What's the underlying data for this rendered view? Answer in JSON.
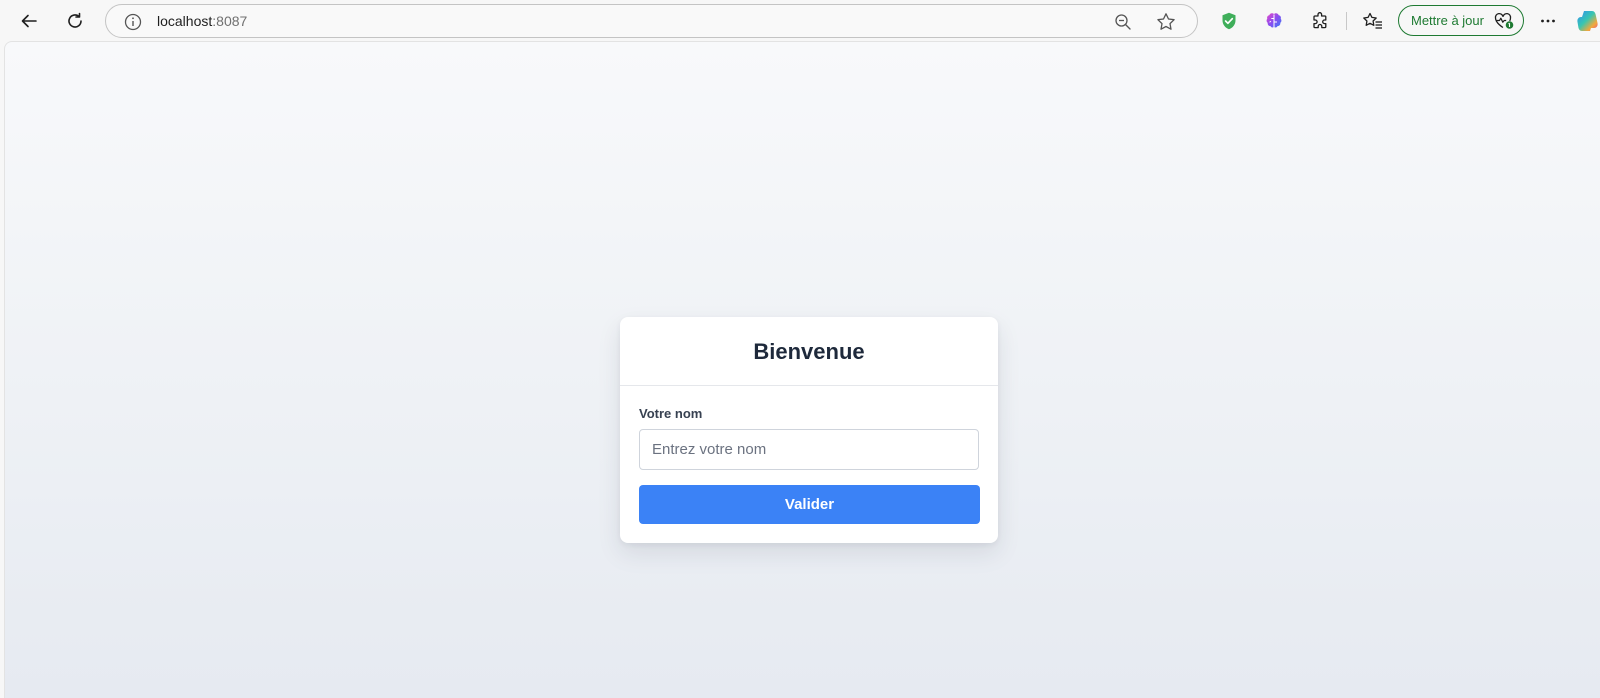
{
  "browser": {
    "address_bar": {
      "host": "localhost",
      "port": ":8087"
    },
    "update_button_label": "Mettre à jour",
    "icons": {
      "back": "back-arrow-icon",
      "reload": "reload-icon",
      "site_info": "info-icon",
      "zoom": "zoom-out-icon",
      "favorite": "star-icon",
      "shield_extension": "shield-icon",
      "brain_extension": "brain-icon",
      "extensions": "puzzle-icon",
      "favorites": "favorites-icon",
      "update_status": "heartbeat-icon",
      "more": "more-icon",
      "copilot": "copilot-icon"
    },
    "colors": {
      "update_accent": "#1e7a32",
      "shield": "#3fae5a"
    }
  },
  "page": {
    "card": {
      "title": "Bienvenue",
      "name_label": "Votre nom",
      "name_input": {
        "value": "",
        "placeholder": "Entrez votre nom"
      },
      "submit_label": "Valider"
    },
    "colors": {
      "primary": "#3b82f6",
      "title": "#1e293b"
    }
  }
}
